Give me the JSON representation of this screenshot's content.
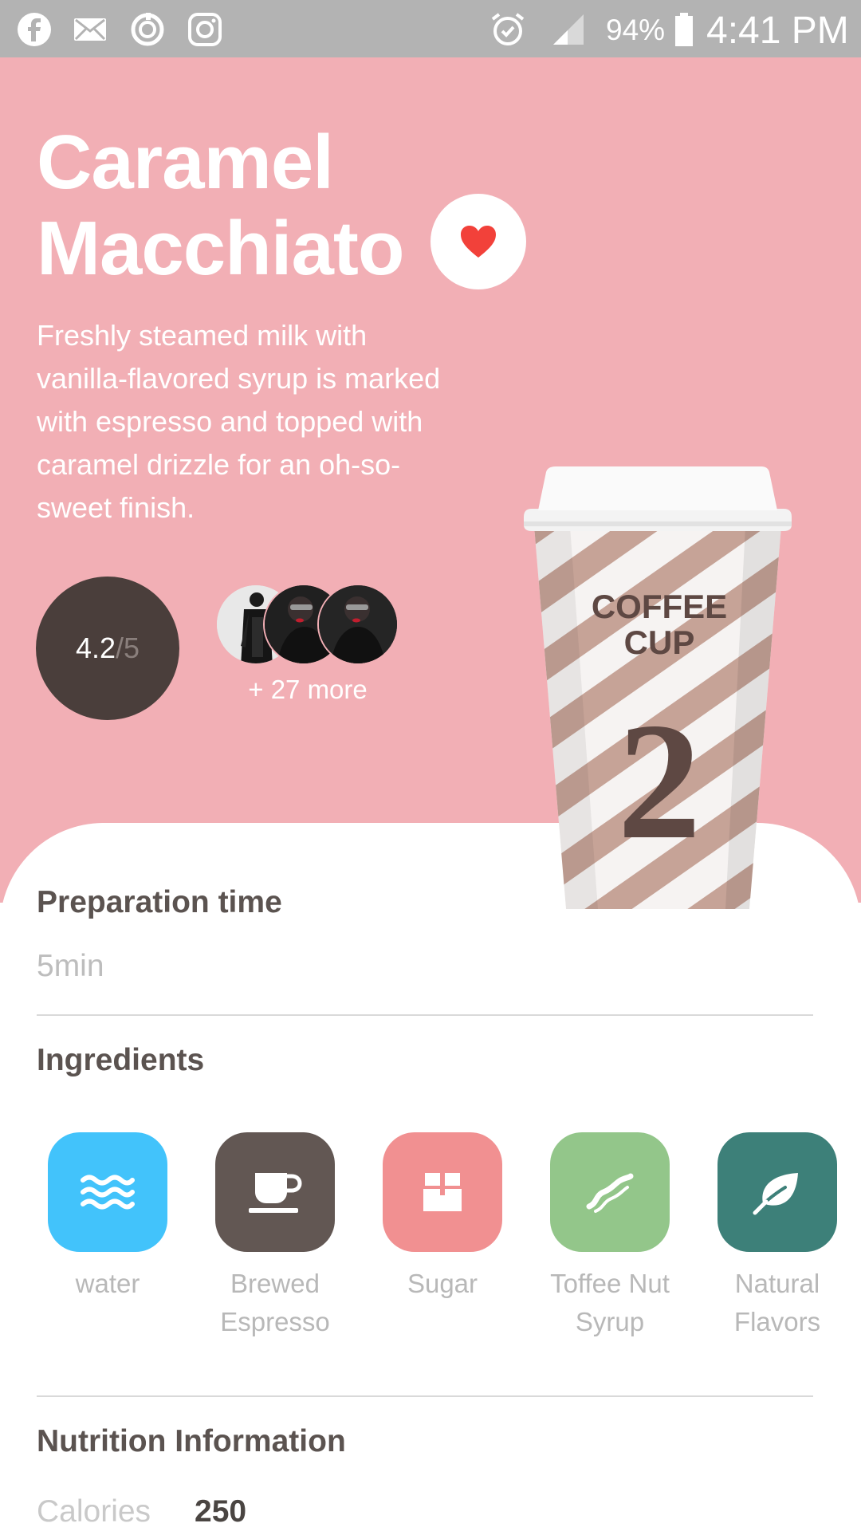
{
  "status_bar": {
    "battery_percent": "94%",
    "time": "4:41 PM",
    "left_icons": [
      "facebook-icon",
      "mail-icon",
      "sync-icon",
      "instagram-icon"
    ],
    "right_icons": [
      "alarm-icon",
      "signal-icon",
      "battery-icon"
    ]
  },
  "drink": {
    "title_line1": "Caramel",
    "title_line2": "Macchiato",
    "description": "Freshly steamed milk with vanilla-flavored syrup is marked with espresso and topped with caramel drizzle for an oh-so-sweet finish.",
    "rating_value": "4.2",
    "rating_max": "/5",
    "reviewers_more": "+ 27 more",
    "favorite": true
  },
  "cup": {
    "brand_line1": "COFFEE",
    "brand_line2": "CUP",
    "number": "2"
  },
  "preparation": {
    "title": "Preparation time",
    "value": "5min"
  },
  "ingredients": {
    "title": "Ingredients",
    "items": [
      {
        "label_line1": "water",
        "label_line2": "",
        "icon": "water-icon",
        "color": "#42c3fb"
      },
      {
        "label_line1": "Brewed",
        "label_line2": "Espresso",
        "icon": "coffee-cup-icon",
        "color": "#625753"
      },
      {
        "label_line1": "Sugar",
        "label_line2": "",
        "icon": "sugar-cube-icon",
        "color": "#f19091"
      },
      {
        "label_line1": "Toffee Nut",
        "label_line2": "Syrup",
        "icon": "syrup-icon",
        "color": "#93c68a"
      },
      {
        "label_line1": "Natural",
        "label_line2": "Flavors",
        "icon": "leaf-icon",
        "color": "#3d8079"
      }
    ]
  },
  "nutrition": {
    "title": "Nutrition Information",
    "calories_label": "Calories",
    "calories_value": "250"
  },
  "colors": {
    "hero_background": "#f2afb5",
    "rating_background": "#4a3e3b",
    "heart": "#f2413a"
  }
}
